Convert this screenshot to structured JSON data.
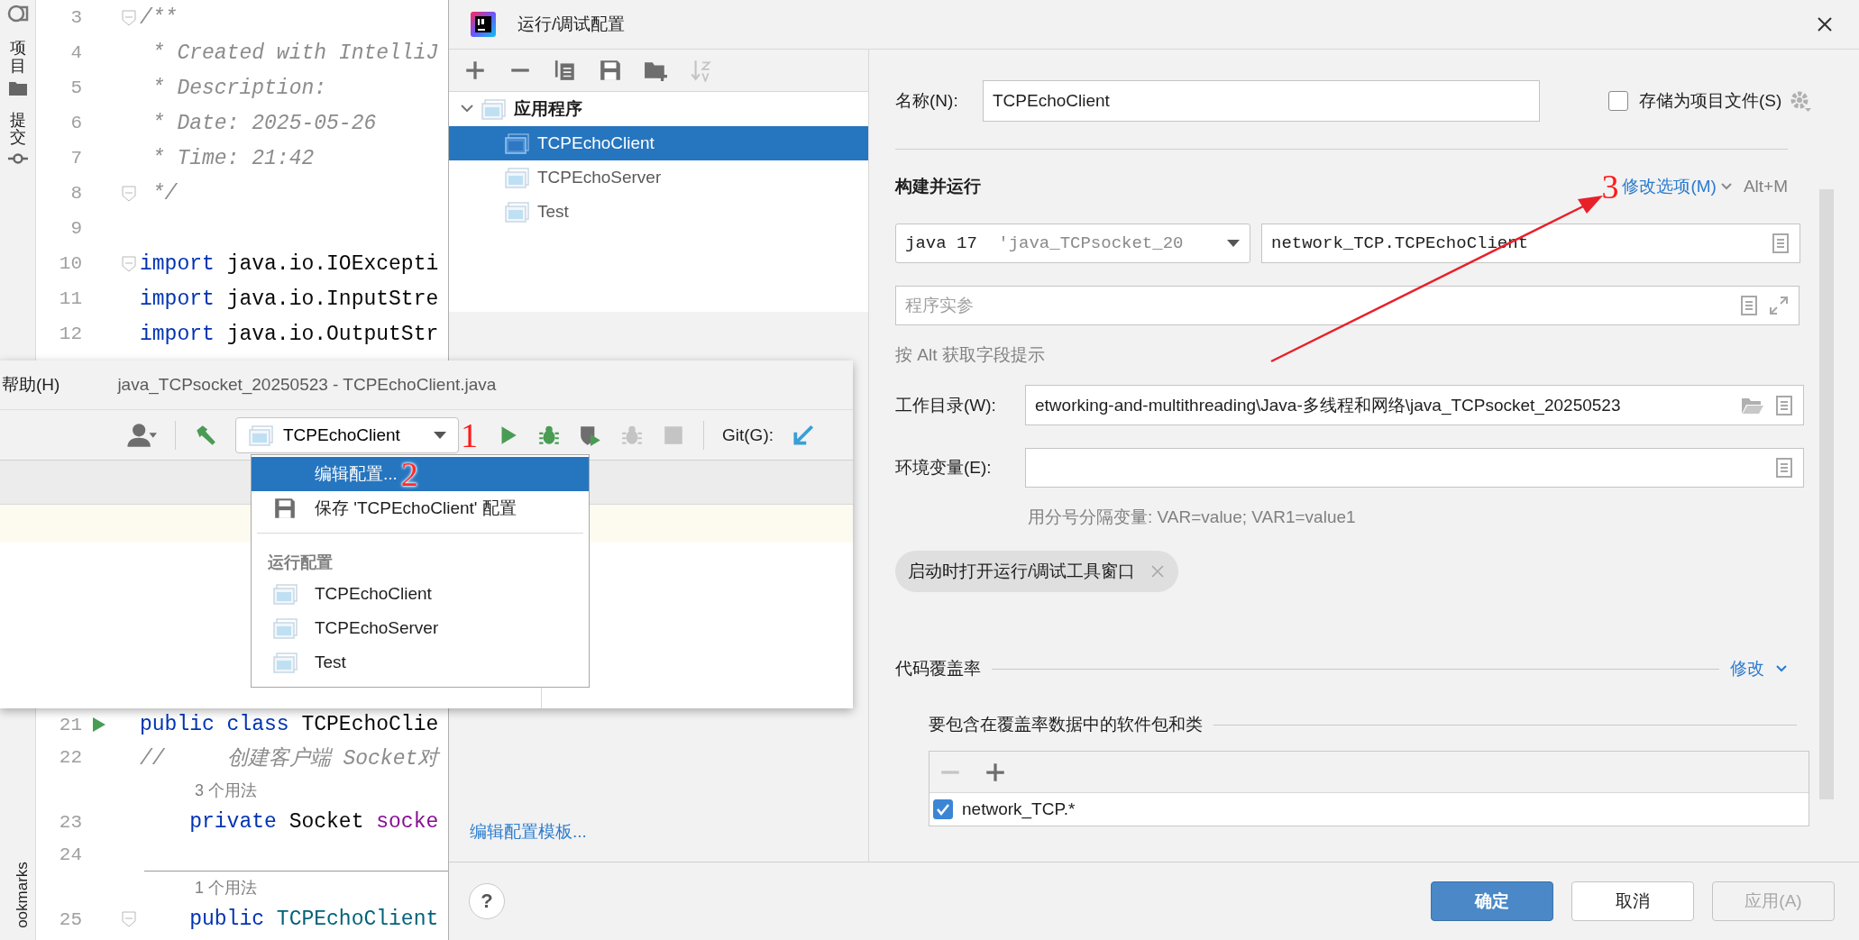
{
  "side_stripe": {
    "top_tabs": [
      {
        "label": "项目",
        "kind": "folder"
      },
      {
        "label": "提交",
        "kind": "commit"
      }
    ],
    "bottom_tab": "ookmarks"
  },
  "editor": {
    "lines_top": [
      {
        "kind": "code",
        "number": "3",
        "fold": true,
        "segments": [
          {
            "text": "/**",
            "kind": "comment"
          }
        ]
      },
      {
        "kind": "code",
        "number": "4",
        "segments": [
          {
            "text": " * Created with IntelliJ",
            "kind": "comment"
          }
        ]
      },
      {
        "kind": "code",
        "number": "5",
        "segments": [
          {
            "text": " * Description:",
            "kind": "comment"
          }
        ]
      },
      {
        "kind": "code",
        "number": "6",
        "segments": [
          {
            "text": " * Date: 2025-05-26",
            "kind": "comment"
          }
        ]
      },
      {
        "kind": "code",
        "number": "7",
        "segments": [
          {
            "text": " * Time: 21:42",
            "kind": "comment"
          }
        ]
      },
      {
        "kind": "code",
        "number": "8",
        "fold": true,
        "segments": [
          {
            "text": " */",
            "kind": "comment"
          }
        ]
      },
      {
        "kind": "code",
        "number": "9"
      },
      {
        "kind": "code",
        "number": "10",
        "fold": true,
        "segments": [
          {
            "text": "import",
            "kind": "keyword"
          },
          {
            "text": " java.io.IOExcepti",
            "kind": "plain"
          }
        ]
      },
      {
        "kind": "code",
        "number": "11",
        "segments": [
          {
            "text": "import",
            "kind": "keyword"
          },
          {
            "text": " java.io.InputStre",
            "kind": "plain"
          }
        ]
      },
      {
        "kind": "code",
        "number": "12",
        "segments": [
          {
            "text": "import",
            "kind": "keyword"
          },
          {
            "text": " java.io.OutputStr",
            "kind": "plain"
          }
        ]
      }
    ],
    "lines_bottom": [
      {
        "kind": "code",
        "number": "21",
        "run": true,
        "segments": [
          {
            "text": "public class",
            "kind": "keyword"
          },
          {
            "text": " TCPEchoClie",
            "kind": "plain"
          }
        ]
      },
      {
        "kind": "code",
        "number": "22",
        "segments": [
          {
            "text": "//     创建客户端 Socket对",
            "kind": "comment"
          }
        ]
      },
      {
        "kind": "hint",
        "text": "3 个用法",
        "separator_above": false
      },
      {
        "kind": "code",
        "number": "23",
        "segments": [
          {
            "text": "    private",
            "kind": "keyword"
          },
          {
            "text": " Socket ",
            "kind": "plain"
          },
          {
            "text": "socke",
            "kind": "field"
          }
        ]
      },
      {
        "kind": "code",
        "number": "24"
      },
      {
        "kind": "hint",
        "text": "1 个用法",
        "separator_above": true
      },
      {
        "kind": "code",
        "number": "25",
        "fold": true,
        "segments": [
          {
            "text": "    public",
            "kind": "keyword"
          },
          {
            "text": " TCPEchoClient",
            "kind": "declaration"
          }
        ]
      }
    ]
  },
  "ide_window": {
    "menu_item": "帮助(H)",
    "title": "java_TCPsocket_20250523 - TCPEchoClient.java",
    "toolbar": {
      "left_icons": [
        {
          "kind": "user",
          "disabled": false
        },
        {
          "kind": "build",
          "disabled": false
        }
      ],
      "run_config": {
        "label": "TCPEchoClient"
      },
      "annotation": "1",
      "action_icons": [
        {
          "kind": "run",
          "disabled": false
        },
        {
          "kind": "debug",
          "disabled": false
        },
        {
          "kind": "coverage",
          "disabled": false
        },
        {
          "kind": "debug",
          "disabled": true
        },
        {
          "kind": "stop",
          "disabled": true
        }
      ],
      "vcs_label": "Git(G):",
      "vcs_icons": [
        {
          "kind": "update",
          "disabled": false
        }
      ]
    },
    "dropdown": {
      "items": [
        {
          "kind": "action",
          "label": "编辑配置...",
          "selected": true,
          "annotation": "2"
        },
        {
          "kind": "save",
          "label": "保存 'TCPEchoClient' 配置",
          "selected": false
        },
        {
          "kind": "separator"
        },
        {
          "kind": "header",
          "label": "运行配置"
        },
        {
          "kind": "config",
          "label": "TCPEchoClient",
          "selected": false
        },
        {
          "kind": "config",
          "label": "TCPEchoServer",
          "selected": false
        },
        {
          "kind": "config",
          "label": "Test",
          "selected": false
        }
      ]
    }
  },
  "dialog": {
    "title": "运行/调试配置",
    "toolbar": [
      {
        "kind": "add",
        "disabled": false
      },
      {
        "kind": "remove",
        "disabled": false
      },
      {
        "kind": "copy",
        "disabled": false
      },
      {
        "kind": "save",
        "disabled": false
      },
      {
        "kind": "folder_add",
        "disabled": false
      },
      {
        "kind": "sort",
        "disabled": true
      }
    ],
    "tree": [
      {
        "label": "应用程序",
        "expanded": true,
        "selected": false,
        "children": [
          {
            "label": "TCPEchoClient",
            "selected": true
          },
          {
            "label": "TCPEchoServer",
            "selected": false
          },
          {
            "label": "Test",
            "selected": false
          }
        ]
      }
    ],
    "templates_link": "编辑配置模板...",
    "name_label": "名称(N):",
    "name_value": "TCPEchoClient",
    "store_label": "存储为项目文件(S)",
    "store_checked": false,
    "section_title": "构建并运行",
    "annotation": "3",
    "modify_link": "修改选项(M)",
    "modify_shortcut": "Alt+M",
    "jre": {
      "value": "java 17",
      "detail": "'java_TCPsocket_20"
    },
    "main_class": "network_TCP.TCPEchoClient",
    "args": {
      "placeholder": "程序实参"
    },
    "alt_hint": "按 Alt 获取字段提示",
    "workdir_label": "工作目录(W):",
    "workdir_value": "etworking-and-multithreading\\Java-多线程和网络\\java_TCPsocket_20250523",
    "env_label": "环境变量(E):",
    "env_hint": "用分号分隔变量: VAR=value; VAR1=value1",
    "chips": [
      {
        "label": "启动时打开运行/调试工具窗口"
      }
    ],
    "coverage_title": "代码覆盖率",
    "coverage_link": "修改",
    "coverage_packages_title": "要包含在覆盖率数据中的软件包和类",
    "packages": [
      {
        "label": "network_TCP.*",
        "checked": true
      }
    ],
    "help_label": "?",
    "buttons": [
      {
        "label": "确定",
        "kind": "primary",
        "disabled": false
      },
      {
        "label": "取消",
        "kind": "normal",
        "disabled": false
      },
      {
        "label": "应用(A)",
        "kind": "normal",
        "disabled": true
      }
    ]
  }
}
